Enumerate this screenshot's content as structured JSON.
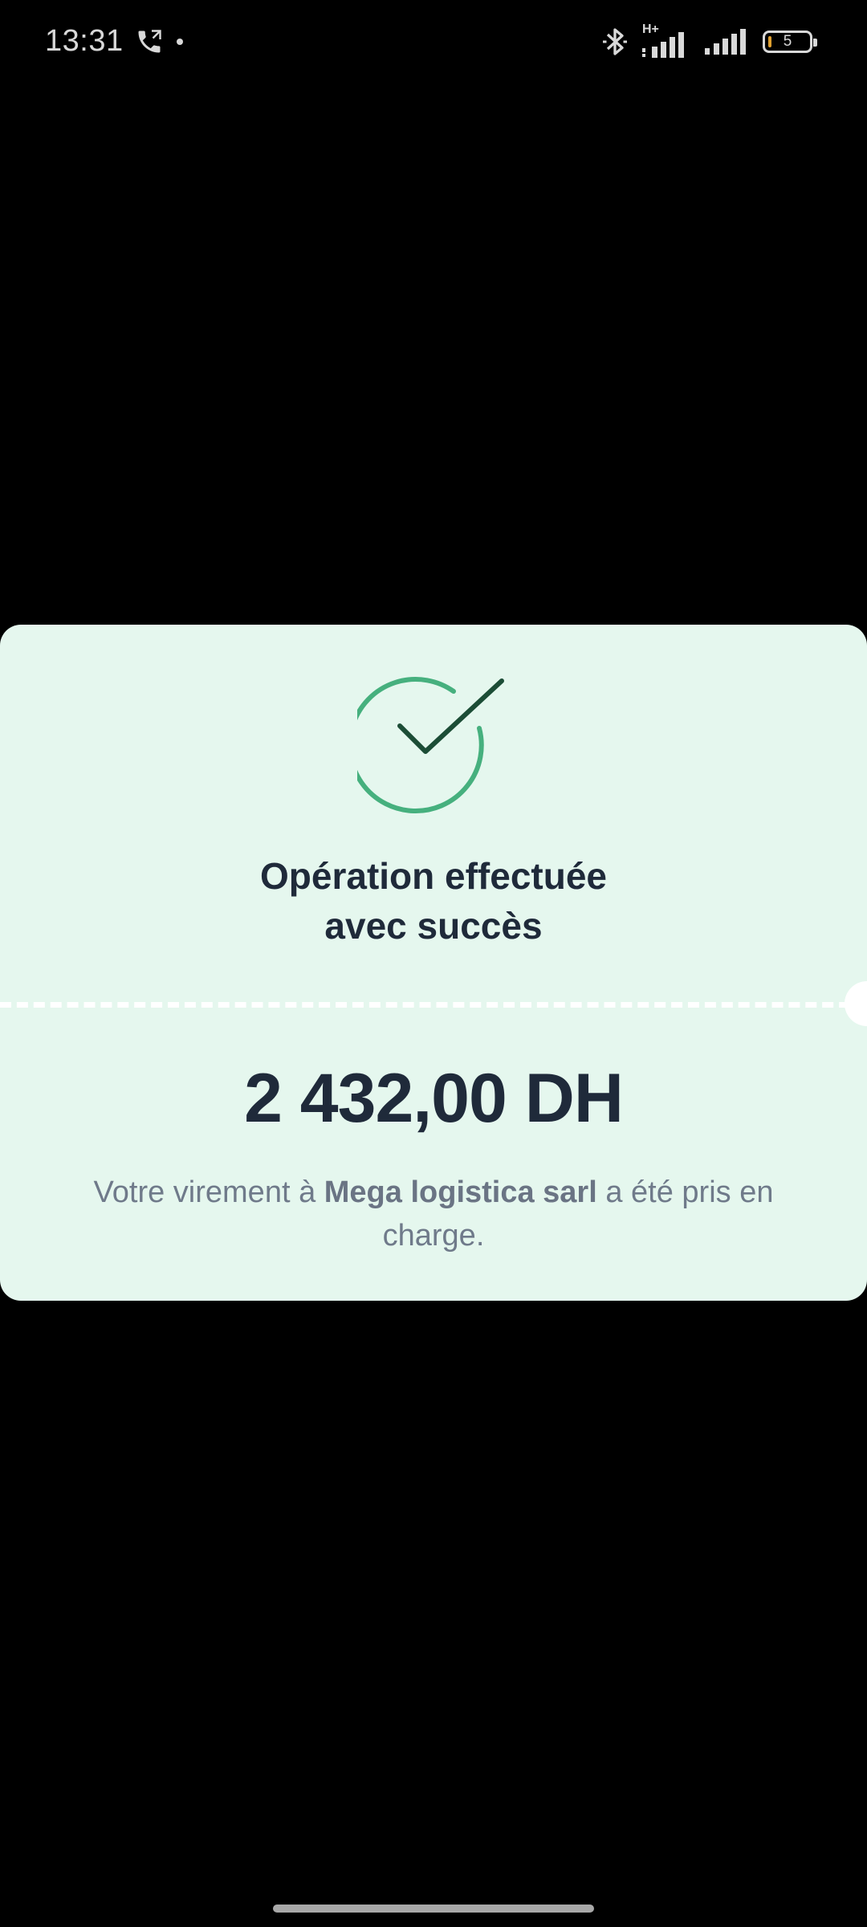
{
  "status_bar": {
    "time": "13:31",
    "network_type": "H+",
    "battery_level": "5",
    "icons": [
      "phone-call-icon",
      "bluetooth-icon",
      "signal-icon",
      "signal-icon",
      "battery-icon"
    ]
  },
  "card": {
    "title_line1": "Opération effectuée",
    "title_line2": "avec succès",
    "amount": "2 432,00 DH",
    "message_before": "Votre virement à ",
    "recipient": "Mega logistica sarl",
    "message_after": " a été pris en charge.",
    "icon": "check-circle-icon"
  },
  "colors": {
    "card_background": "#e5f7ee",
    "check_circle": "#46b07e",
    "check_mark": "#1c4d36",
    "title_text": "#1f2a3a",
    "message_text": "#6f7a8a"
  }
}
